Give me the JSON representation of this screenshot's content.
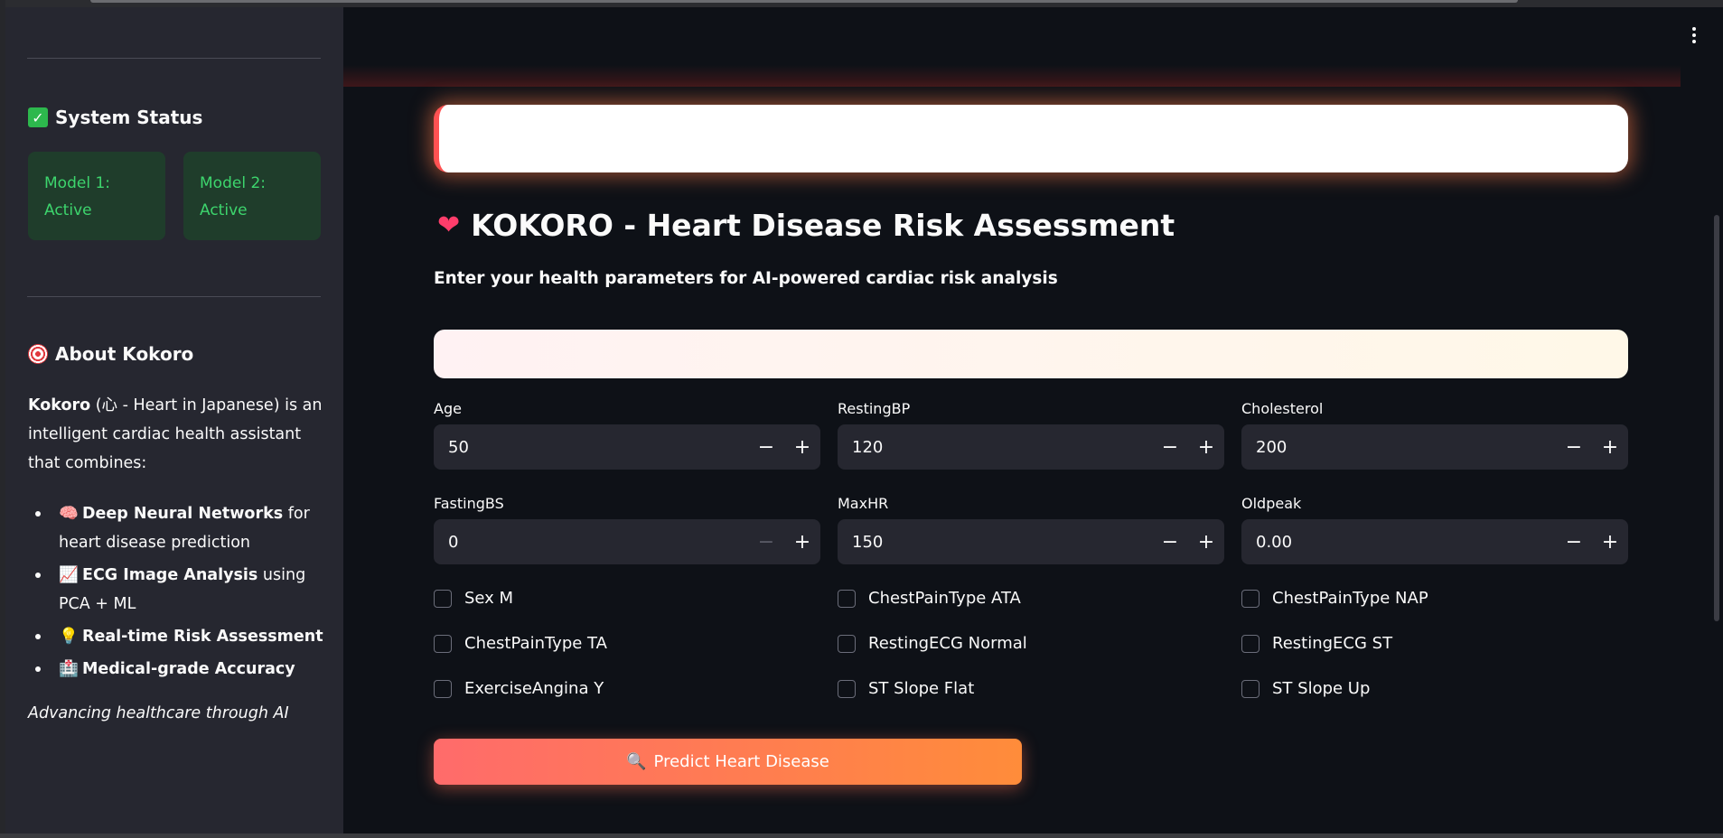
{
  "sidebar": {
    "status_title": "System Status",
    "model1": [
      "Model 1:",
      "Active"
    ],
    "model2": [
      "Model 2:",
      "Active"
    ],
    "about_title": "About Kokoro",
    "about_bold": "Kokoro",
    "about_text": " (心 - Heart in Japanese) is an intelligent cardiac health assistant that combines:",
    "features": [
      {
        "icon": "brain-icon",
        "glyph": "🧠",
        "bold": "Deep Neural Networks",
        "text": " for heart disease prediction"
      },
      {
        "icon": "chart-icon",
        "glyph": "📈",
        "bold": "ECG Image Analysis",
        "text": " using PCA + ML"
      },
      {
        "icon": "lightbulb-icon",
        "glyph": "💡",
        "bold": "Real-time Risk Assessment",
        "text": ""
      },
      {
        "icon": "hospital-icon",
        "glyph": "🏥",
        "bold": "Medical-grade Accuracy",
        "text": ""
      }
    ],
    "tagline": "Advancing healthcare through AI"
  },
  "main": {
    "title": "KOKORO - Heart Disease Risk Assessment",
    "subtitle": "Enter your health parameters for AI-powered cardiac risk analysis",
    "fields": [
      {
        "label": "Age",
        "value": "50"
      },
      {
        "label": "RestingBP",
        "value": "120"
      },
      {
        "label": "Cholesterol",
        "value": "200"
      },
      {
        "label": "FastingBS",
        "value": "0"
      },
      {
        "label": "MaxHR",
        "value": "150"
      },
      {
        "label": "Oldpeak",
        "value": "0.00"
      }
    ],
    "checkboxes": [
      "Sex M",
      "ChestPainType ATA",
      "ChestPainType NAP",
      "ChestPainType TA",
      "RestingECG Normal",
      "RestingECG ST",
      "ExerciseAngina Y",
      "ST Slope Flat",
      "ST Slope Up"
    ],
    "predict_label": "Predict Heart Disease",
    "minus": "−",
    "plus": "+"
  },
  "colors": {
    "accent_green": "#3dd56d",
    "accent_red": "#ff5252",
    "button_gradient": [
      "#ff6b6b",
      "#ff8c3a"
    ]
  }
}
